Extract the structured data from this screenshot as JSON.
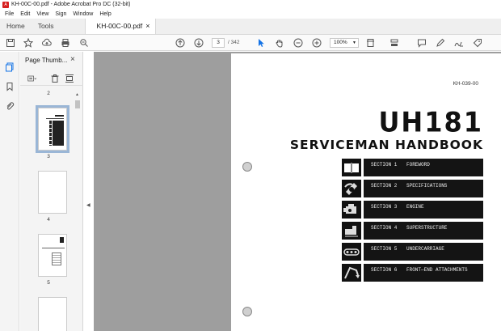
{
  "window": {
    "title": "KH-00C-00.pdf - Adobe Acrobat Pro DC (32-bit)",
    "app_icon": "acrobat-icon"
  },
  "menu": [
    "File",
    "Edit",
    "View",
    "Sign",
    "Window",
    "Help"
  ],
  "tabs": {
    "home": "Home",
    "tools": "Tools",
    "document": "KH-00C-00.pdf",
    "close": "×"
  },
  "toolbar": {
    "page_current": "3",
    "page_total": "/ 342",
    "zoom": "100%"
  },
  "panel": {
    "title": "Page Thumb...",
    "close": "×"
  },
  "thumbnails": [
    {
      "label": "2"
    },
    {
      "label": "3",
      "selected": true
    },
    {
      "label": "4"
    },
    {
      "label": "5"
    }
  ],
  "document": {
    "doc_number": "KH-039-00",
    "title": "UH181",
    "subtitle": "SERVICEMAN HANDBOOK",
    "sections": [
      {
        "number": "SECTION 1",
        "name": "FOREWORD",
        "icon": "book-icon"
      },
      {
        "number": "SECTION 2",
        "name": "SPECIFICATIONS",
        "icon": "specifications-icon"
      },
      {
        "number": "SECTION 3",
        "name": "ENGINE",
        "icon": "engine-icon"
      },
      {
        "number": "SECTION 4",
        "name": "SUPERSTRUCTURE",
        "icon": "superstructure-icon"
      },
      {
        "number": "SECTION 5",
        "name": "UNDERCARRIAGE",
        "icon": "undercarriage-icon"
      },
      {
        "number": "SECTION 6",
        "name": "FRONT—END ATTACHMENTS",
        "icon": "attachments-icon"
      }
    ]
  },
  "colors": {
    "accent": "#1473e6",
    "acrobat_red": "#d6201f",
    "section_bar": "#141414",
    "doc_bg": "#9e9e9e"
  }
}
